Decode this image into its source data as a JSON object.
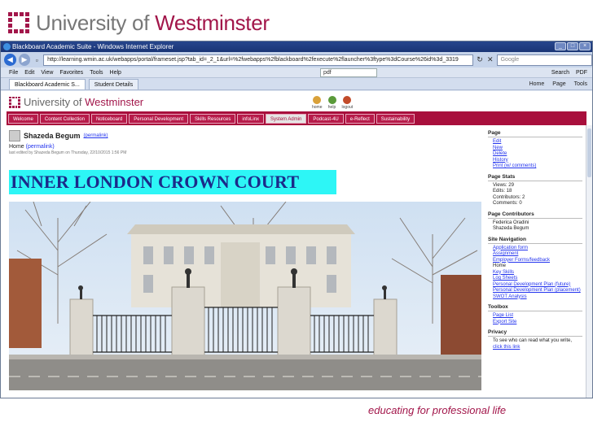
{
  "slide": {
    "logo_text_plain": "University of ",
    "logo_text_brand": "Westminster",
    "tagline": "educating for professional life"
  },
  "browser": {
    "title": "Blackboard Academic Suite - Windows Internet Explorer",
    "address": "http://learning.wmin.ac.uk/webapps/portal/frameset.jsp?tab_id=_2_1&url=%2fwebapps%2fblackboard%2fexecute%2flauncher%3ftype%3dCourse%26id%3d_3319",
    "search_placeholder": "Google",
    "menu": [
      "File",
      "Edit",
      "View",
      "Favorites",
      "Tools",
      "Help"
    ],
    "pdf_box": "pdf",
    "menu_right": [
      "Search",
      "PDF"
    ],
    "tabs": [
      "Blackboard Academic S...",
      "Student Details"
    ],
    "tab_tools": [
      "Home",
      "Page",
      "Tools"
    ]
  },
  "bb": {
    "logo_plain": "University of ",
    "logo_brand": "Westminster",
    "icons": [
      "home",
      "help",
      "logout"
    ],
    "nav": [
      "Welcome",
      "Content Collection",
      "Noticeboard",
      "Personal Development",
      "Skills Resources",
      "infoLinx",
      "System Admin",
      "Podcast-4U",
      "e-Reflect",
      "Sustainability"
    ]
  },
  "post": {
    "user": "Shazeda Begum",
    "permalink": "(permalink)",
    "home_label": "Home",
    "home_permalink": "(permalink)",
    "edited": "last edited by Shazeda Begum on Thursday, 22/10/2015 1:56 PM",
    "banner": "INNER LONDON CROWN COURT"
  },
  "sidebar": {
    "page": {
      "heading": "Page",
      "links": [
        "Edit",
        "New",
        "Delete",
        "History",
        "Print (w/ comments)"
      ]
    },
    "stats": {
      "heading": "Page Stats",
      "lines": [
        "Views: 29",
        "Edits: 18",
        "Contributors: 2",
        "Comments: 0"
      ]
    },
    "contributors": {
      "heading": "Page Contributors",
      "lines": [
        "Federica Oradini",
        "Shazeda Begum"
      ]
    },
    "site_nav": {
      "heading": "Site Navigation",
      "links": [
        "Application form",
        "Assignment",
        "Employer Forms/feedback",
        "Home",
        "Key Skills",
        "Log Sheets",
        "Personal Development Plan (future)",
        "Personal Development Plan (placement)",
        "SWOT Analysis"
      ]
    },
    "toolbox": {
      "heading": "Toolbox",
      "links": [
        "Page List",
        "Export Site"
      ]
    },
    "privacy": {
      "heading": "Privacy",
      "lines": [
        "To see who can read what you write,"
      ],
      "link": "click this link"
    }
  }
}
